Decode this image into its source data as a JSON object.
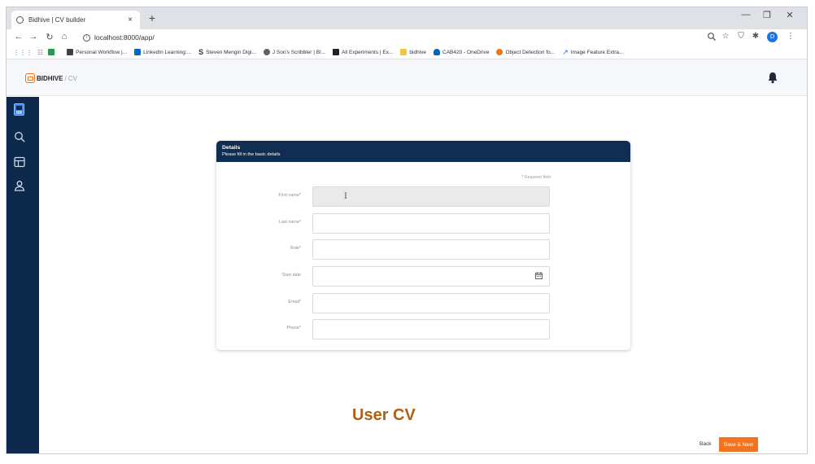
{
  "browser": {
    "tab_title": "Bidhive | CV builder",
    "tab_close": "×",
    "new_tab": "+",
    "url": "localhost:8000/app/",
    "profile_initial": "D",
    "bookmarks": [
      {
        "label": "Personal Workflow |...",
        "color": "#3c4043"
      },
      {
        "label": "LinkedIn Learning:...",
        "color": "#0a66c2"
      },
      {
        "label": "Steven Mengin Digi...",
        "color": "#111111"
      },
      {
        "label": "J Son's Scribbler | Bl...",
        "color": "#5f6368"
      },
      {
        "label": "All Experiments | Ex...",
        "color": "#222222"
      },
      {
        "label": "bidhive",
        "color": "#f4c542"
      },
      {
        "label": "CAB420 - OneDrive",
        "color": "#0364b8"
      },
      {
        "label": "Object Detection fo...",
        "color": "#e8761d"
      },
      {
        "label": "Image Feature Extra...",
        "color": "#1a73e8"
      }
    ]
  },
  "app": {
    "brand": "BIDHIVE",
    "section": "/ CV",
    "accent": "#e8761d",
    "sidebar_color": "#0d2a4d",
    "sidebar_items": [
      {
        "icon": "document-icon",
        "active": true
      },
      {
        "icon": "search-icon",
        "active": false
      },
      {
        "icon": "layout-icon",
        "active": false
      },
      {
        "icon": "user-icon",
        "active": false
      }
    ]
  },
  "form": {
    "title": "Details",
    "subtitle": "Please fill in the basic details",
    "required_note": "Required field",
    "required_marker": "*",
    "fields": [
      {
        "label": "First name*",
        "value": "",
        "disabled": true
      },
      {
        "label": "Last name*",
        "value": "",
        "disabled": false
      },
      {
        "label": "Role*",
        "value": "",
        "disabled": false
      },
      {
        "label": "Start date",
        "value": "",
        "disabled": false,
        "icon": "calendar-icon"
      },
      {
        "label": "Email*",
        "value": "",
        "disabled": false
      },
      {
        "label": "Phone*",
        "value": "",
        "disabled": false
      }
    ]
  },
  "page": {
    "heading": "User CV",
    "back_label": "Back",
    "next_label": "Save & Next"
  }
}
